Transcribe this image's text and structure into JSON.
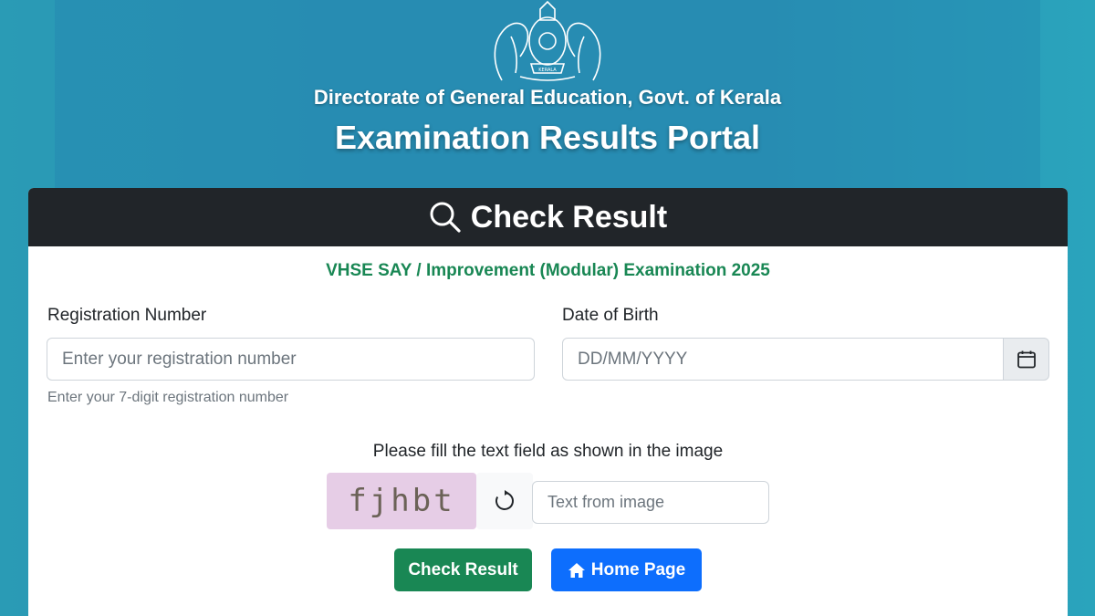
{
  "header": {
    "directorate": "Directorate of General Education, Govt. of Kerala",
    "portal_title": "Examination Results Portal",
    "emblem_icon": "kerala-state-emblem"
  },
  "card": {
    "title": "Check Result",
    "title_icon": "search-icon",
    "exam_name": "VHSE SAY / Improvement (Modular) Examination 2025"
  },
  "form": {
    "registration": {
      "label": "Registration Number",
      "placeholder": "Enter your registration number",
      "value": "",
      "help": "Enter your 7-digit registration number"
    },
    "dob": {
      "label": "Date of Birth",
      "placeholder": "DD/MM/YYYY",
      "value": "",
      "button_icon": "calendar-icon"
    },
    "captcha": {
      "prompt": "Please fill the text field as shown in the image",
      "image_text": "fjhbt",
      "refresh_icon": "refresh-icon",
      "placeholder": "Text from image",
      "value": ""
    }
  },
  "buttons": {
    "check_result": "Check Result",
    "home_page": "Home Page",
    "home_icon": "home-icon"
  },
  "colors": {
    "background": "#2a93b4",
    "card_header": "#212529",
    "exam_name": "#198754",
    "check_button": "#198754",
    "home_button": "#0d6efd",
    "captcha_bg": "#e6cde6"
  }
}
